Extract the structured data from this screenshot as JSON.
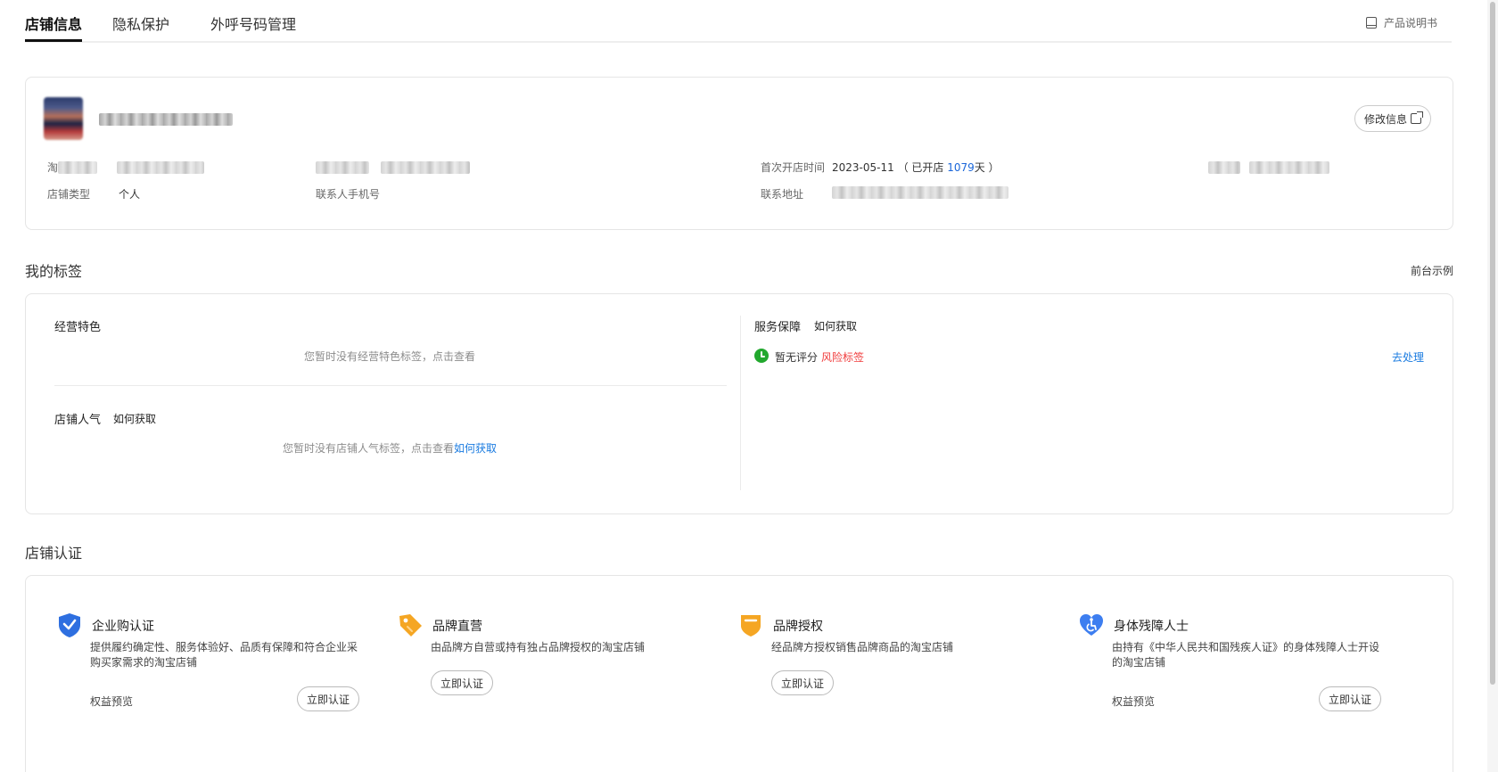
{
  "tabs": [
    {
      "label": "店铺信息"
    },
    {
      "label": "隐私保护"
    },
    {
      "label": "外呼号码管理"
    }
  ],
  "manual_label": "产品说明书",
  "store": {
    "edit_label": "修改信息",
    "taobao_label_prefix": "淘",
    "shop_type_label": "店铺类型",
    "shop_type_value": "个人",
    "contact_phone_label": "联系人手机号",
    "first_open_label": "首次开店时间",
    "first_open_date": "2023-05-11",
    "open_days_prefix": "（ 已开店 ",
    "open_days_value": "1079",
    "open_days_suffix": "天 ）",
    "address_label": "联系地址"
  },
  "tags_section": {
    "title": "我的标签",
    "front_example": "前台示例",
    "business_heading": "经营特色",
    "business_empty": "您暂时没有经营特色标签，点击查看",
    "popularity_heading": "店铺人气",
    "how_to_get": "如何获取",
    "popularity_empty": "您暂时没有店铺人气标签，点击查看",
    "popularity_link": "如何获取",
    "service_heading": "服务保障",
    "service_how_to_get": "如何获取",
    "no_rating": "暂无评分",
    "risk_tag": "风险标签",
    "handle": "去处理"
  },
  "cert_section": {
    "title": "店铺认证",
    "items": [
      {
        "title": "企业购认证",
        "desc": "提供履约确定性、服务体验好、品质有保障和符合企业采购买家需求的淘宝店铺",
        "benefit": "权益预览",
        "button": "立即认证"
      },
      {
        "title": "品牌直营",
        "desc": "由品牌方自营或持有独占品牌授权的淘宝店铺",
        "button": "立即认证"
      },
      {
        "title": "品牌授权",
        "desc": "经品牌方授权销售品牌商品的淘宝店铺",
        "button": "立即认证"
      },
      {
        "title": "身体残障人士",
        "desc": "由持有《中华人民共和国残疾人证》的身体残障人士开设的淘宝店铺",
        "benefit": "权益预览",
        "button": "立即认证"
      }
    ]
  },
  "colors": {
    "link": "#1a7be0",
    "risk": "#f03c3c",
    "ok": "#22a82e",
    "enterprise_icon": "#2e6fe0",
    "brand_icon": "#f5a623",
    "disability_icon": "#3d7ef0"
  },
  "icons": [
    "book-icon",
    "external-link-icon",
    "clock-icon",
    "shield-check-icon",
    "tag-icon",
    "badge-icon",
    "accessibility-heart-icon"
  ]
}
